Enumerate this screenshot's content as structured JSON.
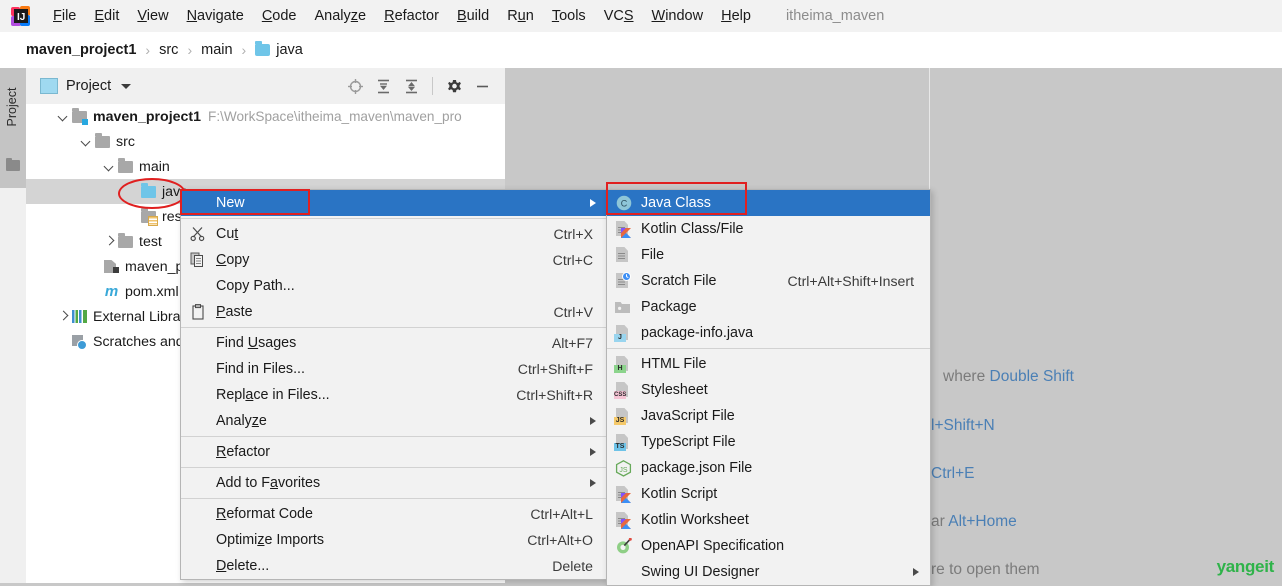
{
  "app": {
    "logo_icon": "intellij-idea-logo",
    "project_label": "itheima_maven"
  },
  "menubar": {
    "items": [
      {
        "label": "File",
        "mnemonic": "F"
      },
      {
        "label": "Edit",
        "mnemonic": "E"
      },
      {
        "label": "View",
        "mnemonic": "V"
      },
      {
        "label": "Navigate",
        "mnemonic": "N"
      },
      {
        "label": "Code",
        "mnemonic": "C"
      },
      {
        "label": "Analyze",
        "mnemonic": "z"
      },
      {
        "label": "Refactor",
        "mnemonic": "R"
      },
      {
        "label": "Build",
        "mnemonic": "B"
      },
      {
        "label": "Run",
        "mnemonic": "u"
      },
      {
        "label": "Tools",
        "mnemonic": "T"
      },
      {
        "label": "VCS",
        "mnemonic": "S"
      },
      {
        "label": "Window",
        "mnemonic": "W"
      },
      {
        "label": "Help",
        "mnemonic": "H"
      }
    ]
  },
  "breadcrumb": {
    "items": [
      "maven_project1",
      "src",
      "main",
      "java"
    ],
    "separator": "›"
  },
  "toolstrip": {
    "label": "Project",
    "icon": "folder-icon"
  },
  "project_window": {
    "title": "Project",
    "title_icon": "project-view-icon",
    "caret_icon": "chevron-down-icon",
    "toolbar_icons": [
      "locate-target-icon",
      "expand-all-icon",
      "collapse-all-icon",
      "settings-gear-icon",
      "hide-minimize-icon"
    ],
    "tree": [
      {
        "label": "maven_project1",
        "path": "F:\\WorkSpace\\itheima_maven\\maven_pro",
        "indent": 0,
        "arrow": "open",
        "icon": "module-folder-icon",
        "bold": true,
        "selected": false
      },
      {
        "label": "src",
        "path": "",
        "indent": 1,
        "arrow": "open",
        "icon": "folder-icon",
        "bold": false,
        "selected": false
      },
      {
        "label": "main",
        "path": "",
        "indent": 2,
        "arrow": "open",
        "icon": "folder-icon",
        "bold": false,
        "selected": false
      },
      {
        "label": "java",
        "path": "",
        "indent": 3,
        "arrow": "none",
        "icon": "source-root-folder-icon",
        "bold": false,
        "selected": true
      },
      {
        "label": "resou",
        "path": "",
        "indent": 3,
        "arrow": "none",
        "icon": "resources-root-folder-icon",
        "bold": false,
        "selected": false
      },
      {
        "label": "test",
        "path": "",
        "indent": 2,
        "arrow": "closed",
        "icon": "folder-icon",
        "bold": false,
        "selected": false
      },
      {
        "label": "maven_pro",
        "path": "",
        "indent": 2,
        "arrow": "none",
        "icon": "module-file-icon",
        "bold": false,
        "selected": false
      },
      {
        "label": "pom.xml",
        "path": "",
        "indent": 2,
        "arrow": "none",
        "icon": "maven-m-icon",
        "bold": false,
        "selected": false
      },
      {
        "label": "External Librar",
        "path": "",
        "indent": 0,
        "arrow": "closed",
        "icon": "external-libraries-icon",
        "bold": false,
        "selected": false
      },
      {
        "label": "Scratches and",
        "path": "",
        "indent": 0,
        "arrow": "none",
        "icon": "scratches-icon",
        "bold": false,
        "selected": false
      }
    ],
    "highlight_ellipse_target": "java"
  },
  "context_menu": {
    "highlight_box_target": "New",
    "items": [
      {
        "label": "New",
        "mnemonic": "",
        "shortcut": "",
        "icon": "",
        "submenu": true,
        "highlighted": true,
        "separator_after": true
      },
      {
        "label": "Cut",
        "mnemonic": "t",
        "shortcut": "Ctrl+X",
        "icon": "scissors-icon",
        "submenu": false,
        "highlighted": false,
        "separator_after": false
      },
      {
        "label": "Copy",
        "mnemonic": "C",
        "shortcut": "Ctrl+C",
        "icon": "copy-icon",
        "submenu": false,
        "highlighted": false,
        "separator_after": false
      },
      {
        "label": "Copy Path...",
        "mnemonic": "",
        "shortcut": "",
        "icon": "",
        "submenu": false,
        "highlighted": false,
        "separator_after": false
      },
      {
        "label": "Paste",
        "mnemonic": "P",
        "shortcut": "Ctrl+V",
        "icon": "clipboard-icon",
        "submenu": false,
        "highlighted": false,
        "separator_after": true
      },
      {
        "label": "Find Usages",
        "mnemonic": "U",
        "shortcut": "Alt+F7",
        "icon": "",
        "submenu": false,
        "highlighted": false,
        "separator_after": false
      },
      {
        "label": "Find in Files...",
        "mnemonic": "",
        "shortcut": "Ctrl+Shift+F",
        "icon": "",
        "submenu": false,
        "highlighted": false,
        "separator_after": false
      },
      {
        "label": "Replace in Files...",
        "mnemonic": "a",
        "shortcut": "Ctrl+Shift+R",
        "icon": "",
        "submenu": false,
        "highlighted": false,
        "separator_after": false
      },
      {
        "label": "Analyze",
        "mnemonic": "z",
        "shortcut": "",
        "icon": "",
        "submenu": true,
        "highlighted": false,
        "separator_after": true
      },
      {
        "label": "Refactor",
        "mnemonic": "R",
        "shortcut": "",
        "icon": "",
        "submenu": true,
        "highlighted": false,
        "separator_after": true
      },
      {
        "label": "Add to Favorites",
        "mnemonic": "a",
        "shortcut": "",
        "icon": "",
        "submenu": true,
        "highlighted": false,
        "separator_after": true
      },
      {
        "label": "Reformat Code",
        "mnemonic": "R",
        "shortcut": "Ctrl+Alt+L",
        "icon": "",
        "submenu": false,
        "highlighted": false,
        "separator_after": false
      },
      {
        "label": "Optimize Imports",
        "mnemonic": "z",
        "shortcut": "Ctrl+Alt+O",
        "icon": "",
        "submenu": false,
        "highlighted": false,
        "separator_after": false
      },
      {
        "label": "Delete...",
        "mnemonic": "D",
        "shortcut": "Delete",
        "icon": "",
        "submenu": false,
        "highlighted": false,
        "separator_after": false
      }
    ]
  },
  "submenu": {
    "highlight_box_target": "Java Class",
    "items": [
      {
        "label": "Java Class",
        "shortcut": "",
        "icon": "java-class-icon",
        "highlighted": true,
        "submenu": false,
        "separator_after": false
      },
      {
        "label": "Kotlin Class/File",
        "shortcut": "",
        "icon": "kotlin-file-icon",
        "highlighted": false,
        "submenu": false,
        "separator_after": false
      },
      {
        "label": "File",
        "shortcut": "",
        "icon": "file-icon",
        "highlighted": false,
        "submenu": false,
        "separator_after": false
      },
      {
        "label": "Scratch File",
        "shortcut": "Ctrl+Alt+Shift+Insert",
        "icon": "scratch-file-icon",
        "highlighted": false,
        "submenu": false,
        "separator_after": false
      },
      {
        "label": "Package",
        "shortcut": "",
        "icon": "package-icon",
        "highlighted": false,
        "submenu": false,
        "separator_after": false
      },
      {
        "label": "package-info.java",
        "shortcut": "",
        "icon": "java-file-icon",
        "highlighted": false,
        "submenu": false,
        "separator_after": true
      },
      {
        "label": "HTML File",
        "shortcut": "",
        "icon": "html-file-icon",
        "highlighted": false,
        "submenu": false,
        "separator_after": false
      },
      {
        "label": "Stylesheet",
        "shortcut": "",
        "icon": "css-file-icon",
        "highlighted": false,
        "submenu": false,
        "separator_after": false
      },
      {
        "label": "JavaScript File",
        "shortcut": "",
        "icon": "js-file-icon",
        "highlighted": false,
        "submenu": false,
        "separator_after": false
      },
      {
        "label": "TypeScript File",
        "shortcut": "",
        "icon": "ts-file-icon",
        "highlighted": false,
        "submenu": false,
        "separator_after": false
      },
      {
        "label": "package.json File",
        "shortcut": "",
        "icon": "nodejs-icon",
        "highlighted": false,
        "submenu": false,
        "separator_after": false
      },
      {
        "label": "Kotlin Script",
        "shortcut": "",
        "icon": "kotlin-file-icon",
        "highlighted": false,
        "submenu": false,
        "separator_after": false
      },
      {
        "label": "Kotlin Worksheet",
        "shortcut": "",
        "icon": "kotlin-file-icon",
        "highlighted": false,
        "submenu": false,
        "separator_after": false
      },
      {
        "label": "OpenAPI Specification",
        "shortcut": "",
        "icon": "openapi-icon",
        "highlighted": false,
        "submenu": false,
        "separator_after": false
      },
      {
        "label": "Swing UI Designer",
        "shortcut": "",
        "icon": "",
        "highlighted": false,
        "submenu": true,
        "separator_after": false
      }
    ]
  },
  "editor_hints": {
    "lines": [
      {
        "text": "where ",
        "accent": "Double Shift",
        "tail": ""
      },
      {
        "text": "",
        "accent": "l+Shift+N",
        "tail": ""
      },
      {
        "text": "",
        "accent": "Ctrl+E",
        "tail": ""
      },
      {
        "text": "ar ",
        "accent": "Alt+Home",
        "tail": ""
      },
      {
        "text": "re to open them",
        "accent": "",
        "tail": ""
      }
    ]
  },
  "watermark": {
    "text": "yangeit",
    "color": "#2fb34a"
  },
  "colors": {
    "menu_highlight": "#2a74c4",
    "annotation_red": "#e02020",
    "panel_bg": "#f2f2f2",
    "editor_bg": "#c8c8c8",
    "accent_blue": "#4a7fb5"
  }
}
